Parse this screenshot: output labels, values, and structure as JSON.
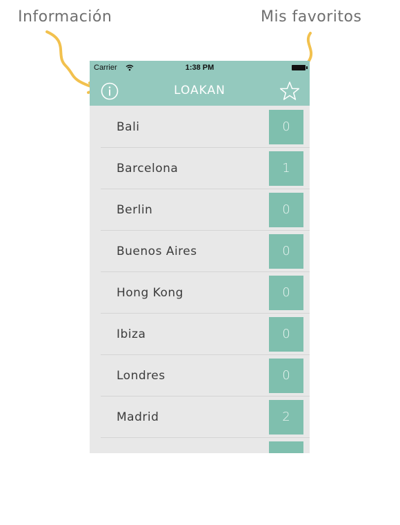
{
  "callouts": {
    "info_label": "Información",
    "favorites_label": "Mis favoritos",
    "arrow_color": "#f2c14e"
  },
  "status_bar": {
    "carrier": "Carrier",
    "time": "1:38 PM"
  },
  "nav": {
    "title": "LOAKAN",
    "info_icon": "info-icon",
    "favorites_icon": "star-icon",
    "background": "#94c9be"
  },
  "cities": [
    {
      "name": "Bali",
      "count": "0"
    },
    {
      "name": "Barcelona",
      "count": "1"
    },
    {
      "name": "Berlin",
      "count": "0"
    },
    {
      "name": "Buenos Aires",
      "count": "0"
    },
    {
      "name": "Hong Kong",
      "count": "0"
    },
    {
      "name": "Ibiza",
      "count": "0"
    },
    {
      "name": "Londres",
      "count": "0"
    },
    {
      "name": "Madrid",
      "count": "2"
    },
    {
      "name": "",
      "count": ""
    }
  ],
  "colors": {
    "count_badge": "#7fbfae",
    "list_background": "#e8e8e8"
  }
}
